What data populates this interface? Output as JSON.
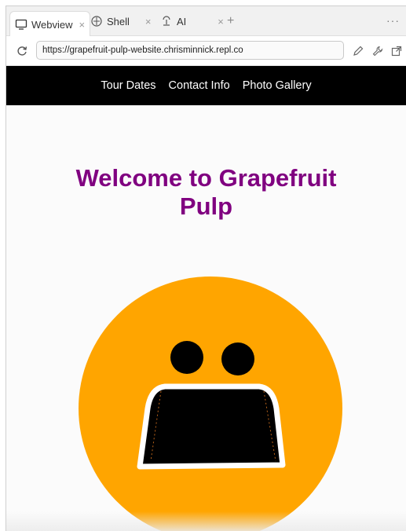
{
  "tabs": [
    {
      "label": "Webview",
      "icon": "monitor-icon",
      "active": true,
      "close": "×"
    },
    {
      "label": "Shell",
      "icon": "shell-icon",
      "active": false,
      "close": "×"
    },
    {
      "label": "AI",
      "icon": "ai-icon",
      "active": false,
      "close": "×"
    }
  ],
  "tab_add": "+",
  "tab_more": "···",
  "url": "https://grapefruit-pulp-website.chrisminnick.repl.co",
  "site": {
    "nav": [
      "Tour Dates",
      "Contact Info",
      "Photo Gallery"
    ],
    "title_line1": "Welcome to Grapefruit",
    "title_line2": "Pulp"
  },
  "colors": {
    "nav_bg": "#000000",
    "title": "#800080",
    "logo_bg": "#FFA500",
    "logo_face": "#000000",
    "logo_outline": "#ffffff"
  }
}
